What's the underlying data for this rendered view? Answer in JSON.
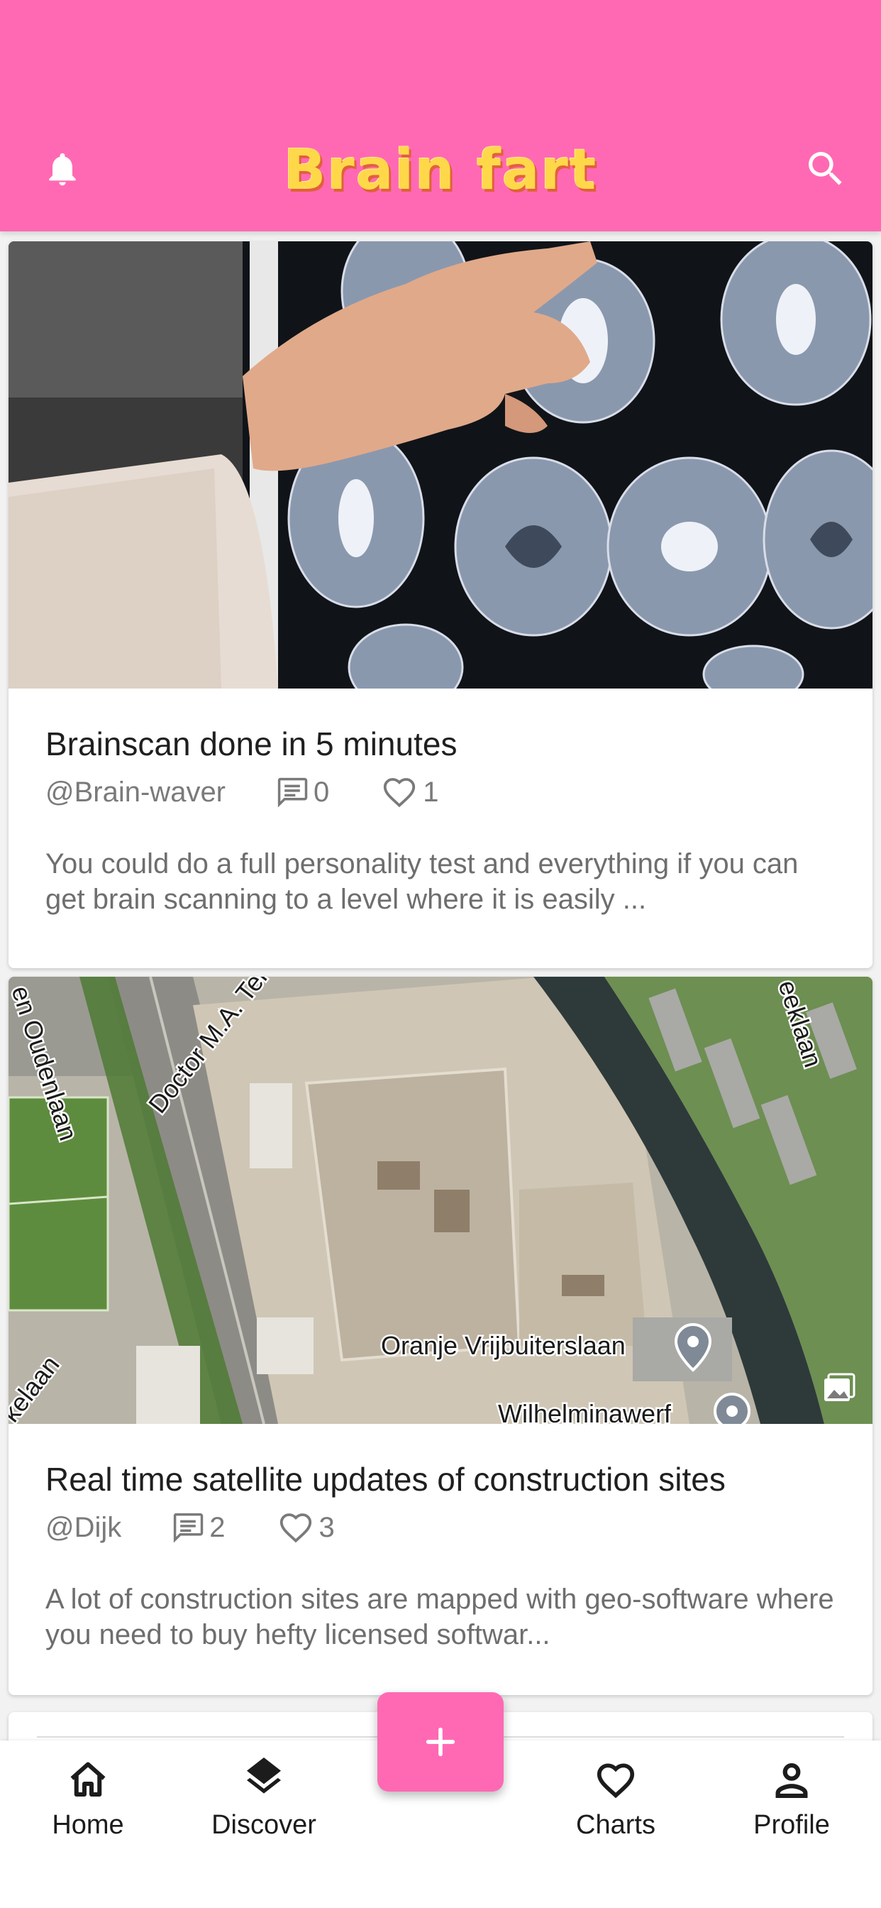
{
  "app": {
    "title": "Brain fart",
    "accent": "#ff69b4",
    "logo_color": "#ffd84a"
  },
  "header": {
    "left_icon": "bell-icon",
    "right_icon": "search-icon"
  },
  "posts": [
    {
      "image": "brain-scan-photo",
      "title": "Brainscan done in 5 minutes",
      "author": "@Brain-waver",
      "comments": "0",
      "likes": "1",
      "excerpt": "You could do a full personality test and everything if you can get brain scanning to a level where it is easily ..."
    },
    {
      "image": "satellite-map-photo",
      "title": "Real time satellite updates of construction sites",
      "author": "@Dijk",
      "comments": "2",
      "likes": "3",
      "excerpt": "A lot of construction sites are mapped with geo-software where you need to buy hefty licensed softwar...",
      "map_labels": {
        "street_1": "Oranje Vrijbuiterslaan",
        "street_2": "Wilhelminawerf",
        "street_3": "Doctor M.A. Tel",
        "street_4": "en Oudenlaan",
        "street_5": "eeklaan",
        "street_6": "kelaan"
      }
    }
  ],
  "fab": {
    "icon": "plus-icon"
  },
  "bottom_nav": [
    {
      "label": "Home",
      "icon": "home-icon"
    },
    {
      "label": "Discover",
      "icon": "layers-icon"
    },
    {
      "label": "Charts",
      "icon": "heart-icon"
    },
    {
      "label": "Profile",
      "icon": "person-icon"
    }
  ]
}
